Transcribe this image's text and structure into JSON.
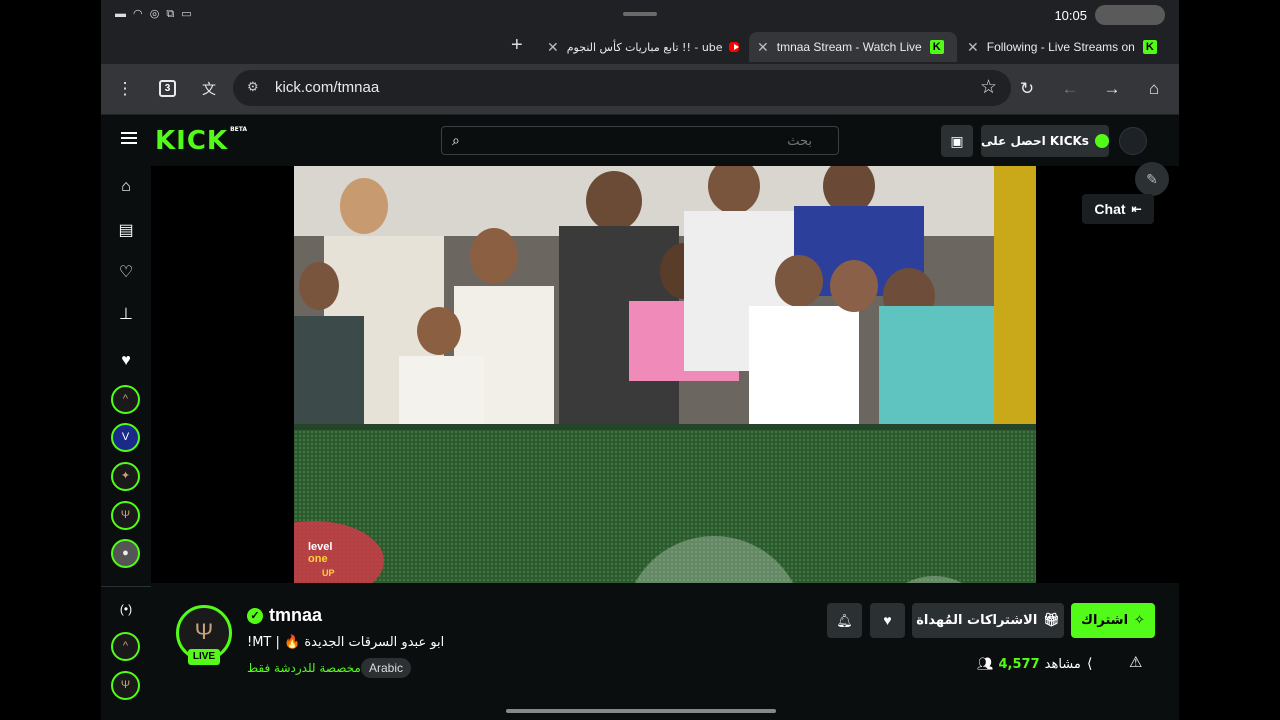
{
  "status_bar": {
    "time": "10:05",
    "left_icons": "▬ ◠ ◎ ⧉ ▭",
    "icons": [
      "battery-icon",
      "wifi-icon",
      "headphones-icon",
      "signal-icon",
      "cast-icon"
    ]
  },
  "tabs": [
    {
      "label": "Following - Live Streams on",
      "favicon": "kick-favicon-icon"
    },
    {
      "label": "tmnaa Stream - Watch Live",
      "favicon": "kick-favicon-icon"
    },
    {
      "label": "تابع مباريات كأس النجوم !! - ube",
      "favicon": "youtube-favicon-icon"
    }
  ],
  "toolbar": {
    "tab_count": "3",
    "url": "kick.com/tmnaa"
  },
  "kick_header": {
    "logo": "KICK",
    "logo_badge": "BETA",
    "search_placeholder": "بحث",
    "kicks_label": "احصل على KICKs"
  },
  "sidebar": {
    "nav": [
      "home-icon",
      "browse-icon",
      "following-icon",
      "clips-icon"
    ],
    "channels": [
      "channel-avatar-1",
      "channel-avatar-2",
      "channel-avatar-3",
      "channel-avatar-4",
      "channel-avatar-5"
    ]
  },
  "video": {
    "chat_label": "Chat"
  },
  "channel": {
    "name": "tmnaa",
    "live_label": "LIVE",
    "title": "ابو عبدو السرقات الجديدة 🔥 | MT!",
    "category": "مخصصة للدردشة فقط",
    "language": "Arabic",
    "viewers": "4,577",
    "viewers_label": "مشاهد",
    "subscribe_label": "اشتراك",
    "gift_label": "الاشتراكات المُهداة"
  },
  "colors": {
    "brand": "#53fc18",
    "bg": "#0b0e0f",
    "chrome": "#35363a"
  }
}
